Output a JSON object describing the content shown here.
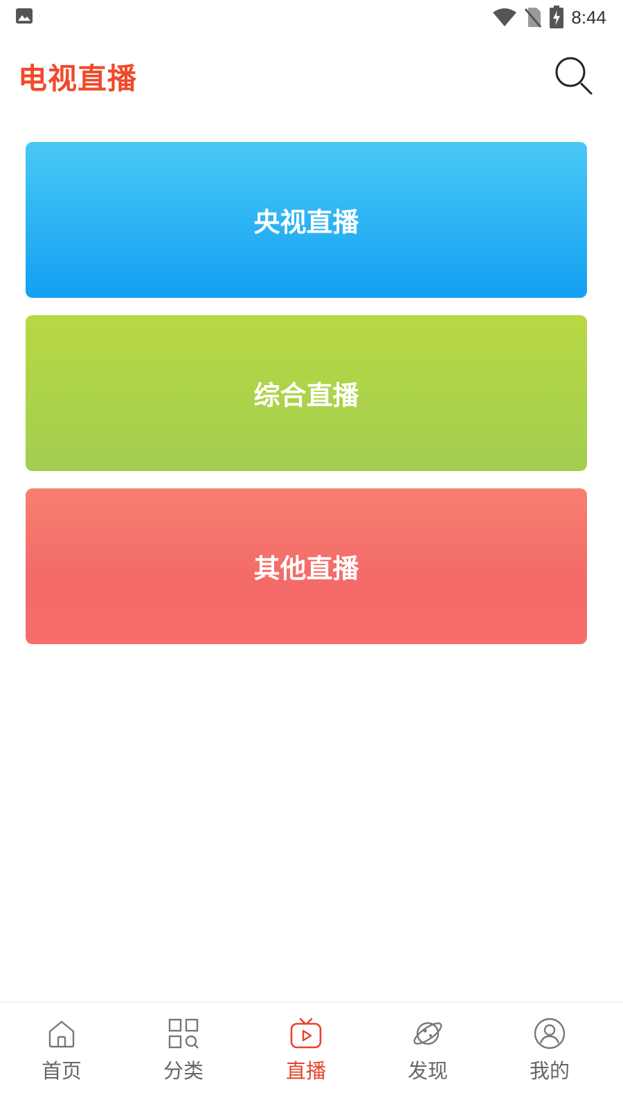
{
  "status_bar": {
    "time": "8:44",
    "icons": [
      "image-icon",
      "wifi-icon",
      "no-sim-icon",
      "battery-charging-icon"
    ]
  },
  "header": {
    "title": "电视直播",
    "search_icon": "search-icon"
  },
  "categories": [
    {
      "label": "央视直播",
      "color_top": "#49c8f5",
      "color_bottom": "#13a0f2"
    },
    {
      "label": "综合直播",
      "color_top": "#b8d843",
      "color_bottom": "#a2ce50"
    },
    {
      "label": "其他直播",
      "color_top": "#f77f6f",
      "color_bottom": "#f86d6c"
    }
  ],
  "bottom_nav": {
    "active_index": 2,
    "active_color": "#e6432a",
    "items": [
      {
        "label": "首页",
        "icon": "home-icon"
      },
      {
        "label": "分类",
        "icon": "category-icon"
      },
      {
        "label": "直播",
        "icon": "tv-icon"
      },
      {
        "label": "发现",
        "icon": "planet-icon"
      },
      {
        "label": "我的",
        "icon": "user-icon"
      }
    ]
  }
}
